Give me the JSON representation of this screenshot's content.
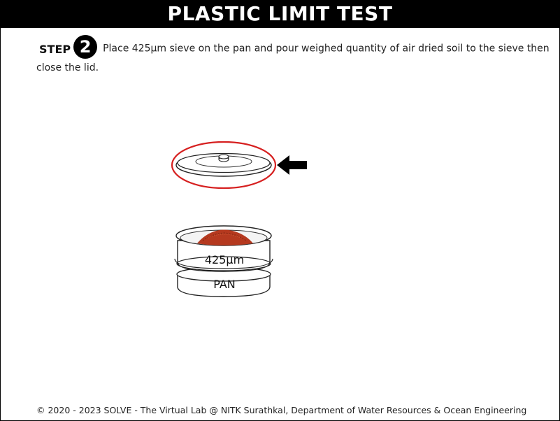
{
  "header": {
    "title": "PLASTIC LIMIT TEST"
  },
  "step": {
    "label": "STEP",
    "number": "2",
    "instruction": "Place 425µm sieve on the pan and pour weighed quantity of air dried soil to the sieve then close the lid."
  },
  "apparatus": {
    "sieve_label": "425µm",
    "pan_label": "PAN",
    "highlight_color": "#d62020",
    "soil_color": "#b5391f"
  },
  "footer": {
    "copyright": "© 2020 - 2023 SOLVE - The Virtual Lab @ NITK Surathkal, Department of Water Resources & Ocean Engineering"
  }
}
